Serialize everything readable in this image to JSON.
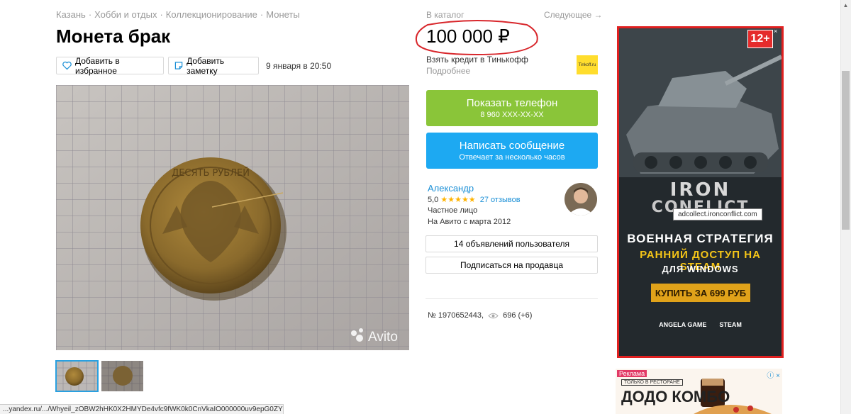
{
  "breadcrumbs": [
    "Казань",
    "Хобби и отдых",
    "Коллекционирование",
    "Монеты"
  ],
  "listing": {
    "title": "Монета брак",
    "favorite_label": "Добавить в избранное",
    "note_label": "Добавить заметку",
    "date": "9 января в 20:50",
    "photo_watermark": "Avito",
    "coin_text": "ДЕСЯТЬ РУБЛЕЙ"
  },
  "nav": {
    "catalog": "В каталог",
    "next": "Следующее →"
  },
  "price": {
    "value": "100 000 ₽",
    "credit": "Взять кредит в Тинькофф",
    "more": "Подробнее",
    "bank_badge": "Tinkoff.ru"
  },
  "actions": {
    "phone_main": "Показать телефон",
    "phone_sub": "8 960 XXX-XX-XX",
    "message_main": "Написать сообщение",
    "message_sub": "Отвечает за несколько часов"
  },
  "seller": {
    "name": "Александр",
    "rating": "5,0",
    "stars": "★★★★★",
    "reviews": "27 отзывов",
    "type": "Частное лицо",
    "since": "На Авито с марта 2012",
    "ads_button": "14 объявлений пользователя",
    "subscribe_button": "Подписаться на продавца"
  },
  "meta": {
    "id": "№ 1970652443,",
    "views": "696 (+6)"
  },
  "status_url": "...yandex.ru/.../Whyeil_zOBW2hHK0X2HMYDe4vfc9fWK0k0CnVkaIO000000uv9epG0ZYbDIlhH...",
  "ad_game": {
    "age": "12+",
    "close": "×",
    "logo_top": "IRON",
    "logo_bottom": "CONFLICT",
    "tooltip": "adcollect.ironconflict.com",
    "line1": "ВОЕННАЯ СТРАТЕГИЯ",
    "line2": "РАННИЙ ДОСТУП НА STEAM",
    "line3": "ДЛЯ WINDOWS",
    "buy": "КУПИТЬ ЗА 699 РУБ",
    "brand1": "ANGELA GAME",
    "brand2": "STEAM"
  },
  "ad_food": {
    "label": "Реклама",
    "sub": "ТОЛЬКО В РЕСТОРАНЕ",
    "title": "ДОДО КОМБО",
    "icons": "ⓘ ×"
  },
  "colors": {
    "phone_button": "#8ac539",
    "message_button": "#1da9f2",
    "link": "#1a8fd6",
    "ad_border": "#e02020",
    "price_circle": "#d8262b"
  }
}
